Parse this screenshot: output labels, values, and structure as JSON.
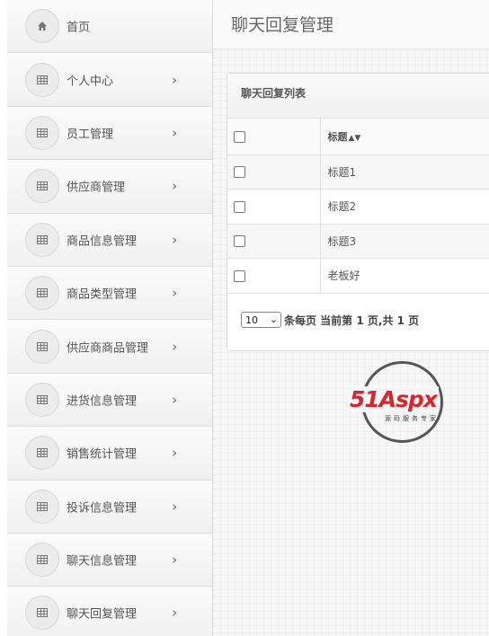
{
  "header": {
    "title": "聊天回复管理"
  },
  "sidebar": {
    "items": [
      {
        "label": "首页",
        "icon": "home-icon",
        "chevron": false
      },
      {
        "label": "个人中心",
        "icon": "table-icon",
        "chevron": true
      },
      {
        "label": "员工管理",
        "icon": "table-icon",
        "chevron": true
      },
      {
        "label": "供应商管理",
        "icon": "table-icon",
        "chevron": true
      },
      {
        "label": "商品信息管理",
        "icon": "table-icon",
        "chevron": true
      },
      {
        "label": "商品类型管理",
        "icon": "table-icon",
        "chevron": true
      },
      {
        "label": "供应商商品管理",
        "icon": "table-icon",
        "chevron": true
      },
      {
        "label": "进货信息管理",
        "icon": "table-icon",
        "chevron": true
      },
      {
        "label": "销售统计管理",
        "icon": "table-icon",
        "chevron": true
      },
      {
        "label": "投诉信息管理",
        "icon": "table-icon",
        "chevron": true
      },
      {
        "label": "聊天信息管理",
        "icon": "table-icon",
        "chevron": true
      },
      {
        "label": "聊天回复管理",
        "icon": "table-icon",
        "chevron": true
      }
    ]
  },
  "panel": {
    "title": "聊天回复列表",
    "table": {
      "header": {
        "title": "标题",
        "sort_icon": "sort-icon"
      },
      "rows": [
        {
          "title": "标题1"
        },
        {
          "title": "标题2"
        },
        {
          "title": "标题3"
        },
        {
          "title": "老板好"
        }
      ]
    },
    "pager": {
      "page_size": "10",
      "text": "条每页 当前第 1 页,共 1 页"
    }
  },
  "watermark": {
    "brand_51": "51",
    "brand_aspx": "Aspx",
    "sub": "源码服务专家"
  },
  "colors": {
    "brand_red": "#d8262e",
    "brand_green": "#3a9a3a"
  }
}
